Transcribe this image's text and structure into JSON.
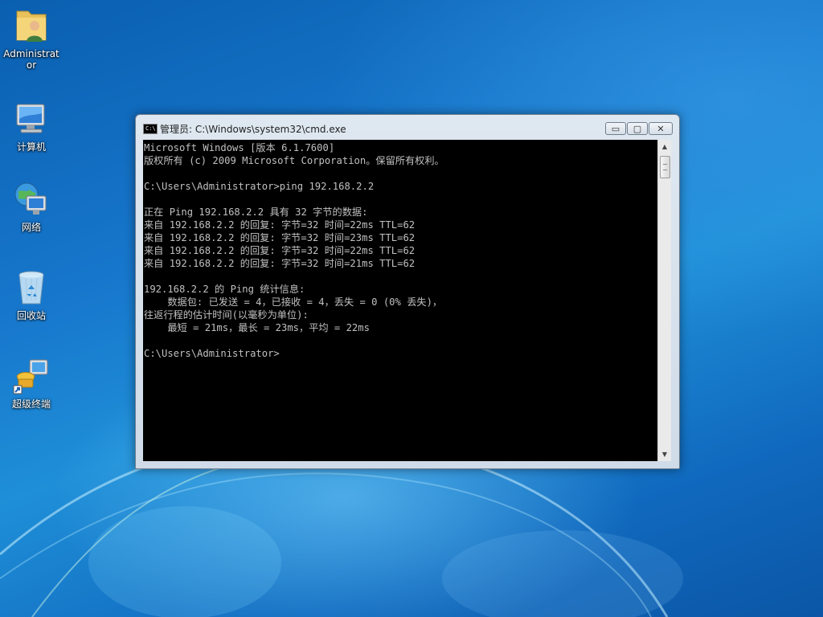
{
  "desktop": {
    "icons": [
      {
        "label": "Administrator",
        "icon": "user-folder-icon"
      },
      {
        "label": "计算机",
        "icon": "computer-icon"
      },
      {
        "label": "网络",
        "icon": "network-icon"
      },
      {
        "label": "回收站",
        "icon": "recycle-bin-icon"
      },
      {
        "label": "超级终端",
        "icon": "hyperterminal-shortcut-icon"
      }
    ]
  },
  "window": {
    "title": "管理员: C:\\Windows\\system32\\cmd.exe",
    "icon_text": "C:\\",
    "buttons": {
      "minimize": "▭",
      "maximize": "▢",
      "close": "✕"
    }
  },
  "console": {
    "lines": [
      "Microsoft Windows [版本 6.1.7600]",
      "版权所有 (c) 2009 Microsoft Corporation。保留所有权利。",
      "",
      "C:\\Users\\Administrator>ping 192.168.2.2",
      "",
      "正在 Ping 192.168.2.2 具有 32 字节的数据:",
      "来自 192.168.2.2 的回复: 字节=32 时间=22ms TTL=62",
      "来自 192.168.2.2 的回复: 字节=32 时间=23ms TTL=62",
      "来自 192.168.2.2 的回复: 字节=32 时间=22ms TTL=62",
      "来自 192.168.2.2 的回复: 字节=32 时间=21ms TTL=62",
      "",
      "192.168.2.2 的 Ping 统计信息:",
      "    数据包: 已发送 = 4，已接收 = 4，丢失 = 0 (0% 丢失)，",
      "往返行程的估计时间(以毫秒为单位):",
      "    最短 = 21ms，最长 = 23ms，平均 = 22ms",
      "",
      "C:\\Users\\Administrator>"
    ]
  }
}
